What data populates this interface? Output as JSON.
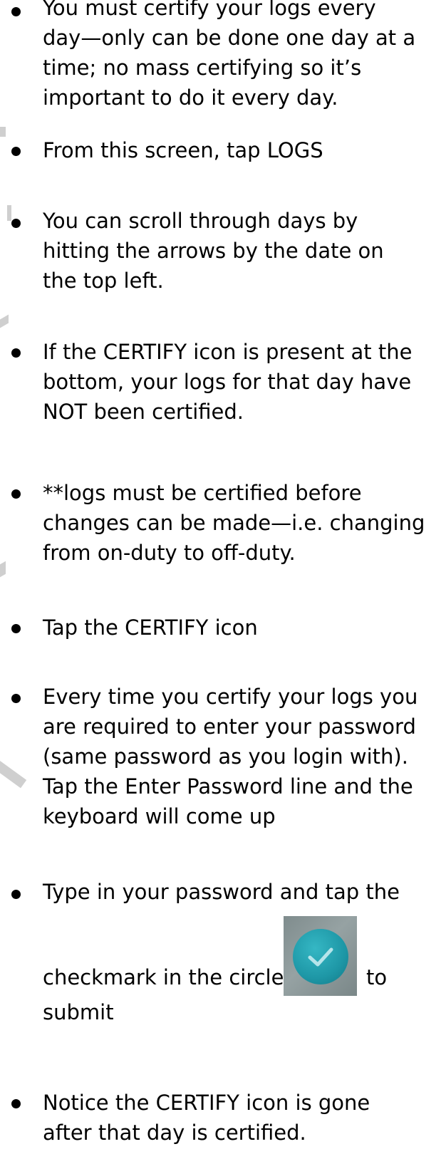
{
  "bullets": [
    {
      "lines": [
        "You must certify your logs every",
        "day—only can be done one day at a",
        "time; no mass certifying so it’s",
        "important to do it every day."
      ]
    },
    {
      "lines": [
        "From this screen, tap LOGS"
      ]
    },
    {
      "lines": [
        "You can scroll through days by",
        "hitting the arrows by the date on",
        "the top left."
      ]
    },
    {
      "lines": [
        "If the CERTIFY icon is present at the",
        "bottom, your logs for that day have",
        "NOT been certified."
      ]
    },
    {
      "lines": [
        "**logs must be certified before",
        "changes can be made—i.e. changing",
        "from on-duty to off-duty."
      ]
    },
    {
      "lines": [
        "Tap the CERTIFY icon"
      ]
    },
    {
      "lines": [
        "Every time you certify your logs you",
        "are required to enter your password",
        "(same password as you login with).",
        "Tap the Enter Password line and the",
        "keyboard will come up"
      ]
    },
    {
      "line1": "Type in your password and tap the",
      "line2_before": "checkmark in the circle",
      "line2_after": "to",
      "line3": "submit",
      "icon": "checkmark-circle-icon",
      "icon_color": "#1e97a6"
    },
    {
      "lines": [
        "Notice the CERTIFY icon is gone",
        "after that day is certified."
      ]
    }
  ]
}
